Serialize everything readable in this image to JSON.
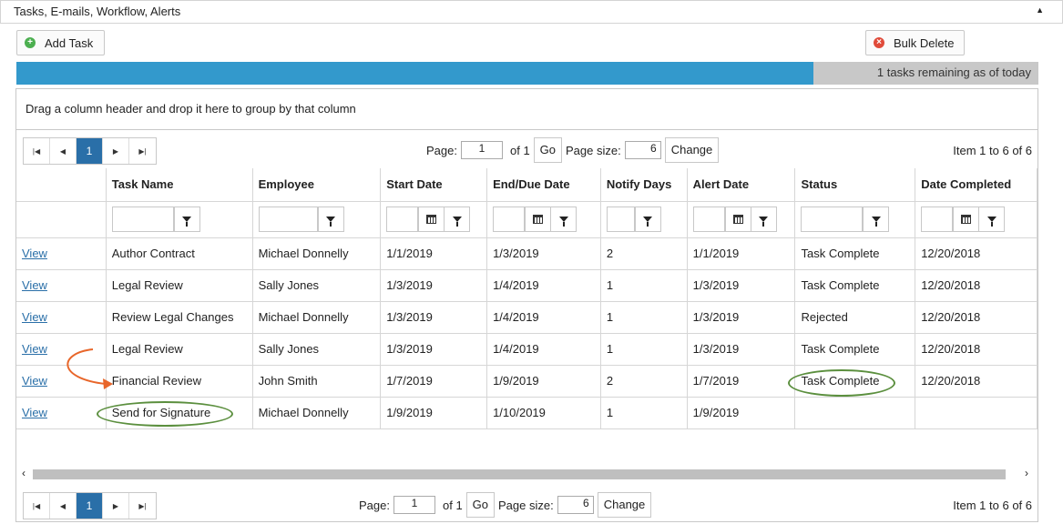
{
  "panel": {
    "title": "Tasks, E-mails, Workflow, Alerts",
    "collapse_icon": "▲"
  },
  "toolbar": {
    "add_task": "Add Task",
    "bulk_delete": "Bulk Delete"
  },
  "progress": {
    "text": "1 tasks remaining as of today",
    "fraction": 0.78,
    "fill_color": "#3399cc"
  },
  "group_hint": "Drag a column header and drop it here to group by that column",
  "pager": {
    "current_page": "1",
    "page_label": "Page:",
    "page_value": "1",
    "of_text": "of 1",
    "go": "Go",
    "size_label": "Page size:",
    "size_value": "6",
    "change": "Change",
    "info": "Item 1 to 6 of 6"
  },
  "columns": [
    "",
    "Task Name",
    "Employee",
    "Start Date",
    "End/Due Date",
    "Notify Days",
    "Alert Date",
    "Status",
    "Date Completed"
  ],
  "rows": [
    [
      "View",
      "Author Contract",
      "Michael Donnelly",
      "1/1/2019",
      "1/3/2019",
      "2",
      "1/1/2019",
      "Task Complete",
      "12/20/2018"
    ],
    [
      "View",
      "Legal Review",
      "Sally Jones",
      "1/3/2019",
      "1/4/2019",
      "1",
      "1/3/2019",
      "Task Complete",
      "12/20/2018"
    ],
    [
      "View",
      "Review Legal Changes",
      "Michael Donnelly",
      "1/3/2019",
      "1/4/2019",
      "1",
      "1/3/2019",
      "Rejected",
      "12/20/2018"
    ],
    [
      "View",
      "Legal Review",
      "Sally Jones",
      "1/3/2019",
      "1/4/2019",
      "1",
      "1/3/2019",
      "Task Complete",
      "12/20/2018"
    ],
    [
      "View",
      "Financial Review",
      "John Smith",
      "1/7/2019",
      "1/9/2019",
      "2",
      "1/7/2019",
      "Task Complete",
      "12/20/2018"
    ],
    [
      "View",
      "Send for Signature",
      "Michael Donnelly",
      "1/9/2019",
      "1/10/2019",
      "1",
      "1/9/2019",
      "",
      ""
    ]
  ],
  "colors": {
    "accent": "#2a6fa8",
    "annotation_green": "#5b8f3e",
    "annotation_orange": "#e8662a",
    "add_icon": "#4caf50",
    "delete_icon": "#e04b3a"
  }
}
